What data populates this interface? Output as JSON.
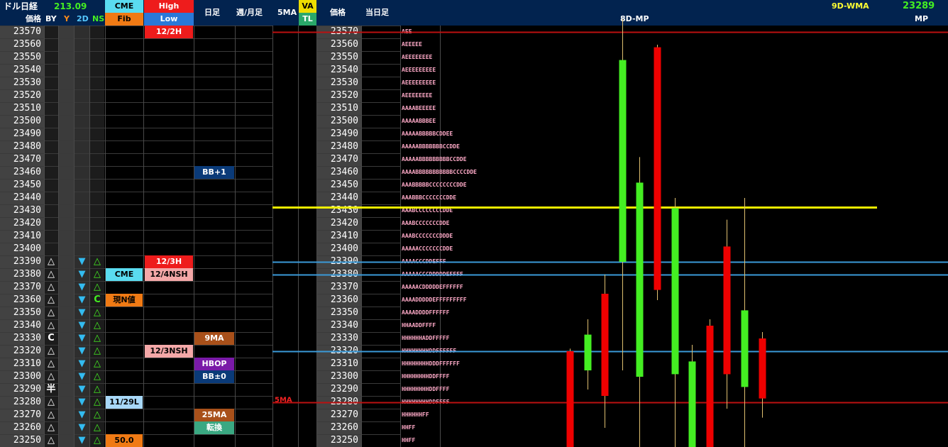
{
  "header": {
    "title": "ドル日経",
    "value": "213.09",
    "price_label": "価格",
    "by": "BY",
    "y": "Y",
    "twod": "2D",
    "ns": "NS",
    "cme": "CME",
    "fib": "Fib",
    "high": "High",
    "low": "Low",
    "daily": "日足",
    "weekly_monthly": "週/月足",
    "ma5": "5MA",
    "va": "VA",
    "tl": "TL",
    "price2": "価格",
    "today_daily": "当日足",
    "mp8d": "8D-MP",
    "wma9d": "9D-WMA",
    "mp_value": "23289",
    "mp": "MP"
  },
  "colors": {
    "header_bg": "#02234f",
    "up_candle": "#44ee22",
    "down_candle": "#ee0000",
    "yellow_line": "#eeee00",
    "blue_line": "#3a9ad8",
    "red_line": "#bb1111"
  },
  "rows": [
    {
      "price": "23570",
      "by": "",
      "y": "",
      "d2": "",
      "ns": "",
      "cme": "",
      "hl": "12/2H",
      "hl_style": "red",
      "daily": ""
    },
    {
      "price": "23560",
      "by": "",
      "y": "",
      "d2": "",
      "ns": "",
      "cme": "",
      "hl": "",
      "hl_style": "",
      "daily": ""
    },
    {
      "price": "23550",
      "by": "",
      "y": "",
      "d2": "",
      "ns": "",
      "cme": "",
      "hl": "",
      "hl_style": "",
      "daily": ""
    },
    {
      "price": "23540",
      "by": "",
      "y": "",
      "d2": "",
      "ns": "",
      "cme": "",
      "hl": "",
      "hl_style": "",
      "daily": ""
    },
    {
      "price": "23530",
      "by": "",
      "y": "",
      "d2": "",
      "ns": "",
      "cme": "",
      "hl": "",
      "hl_style": "",
      "daily": ""
    },
    {
      "price": "23520",
      "by": "",
      "y": "",
      "d2": "",
      "ns": "",
      "cme": "",
      "hl": "",
      "hl_style": "",
      "daily": ""
    },
    {
      "price": "23510",
      "by": "",
      "y": "",
      "d2": "",
      "ns": "",
      "cme": "",
      "hl": "",
      "hl_style": "",
      "daily": ""
    },
    {
      "price": "23500",
      "by": "",
      "y": "",
      "d2": "",
      "ns": "",
      "cme": "",
      "hl": "",
      "hl_style": "",
      "daily": ""
    },
    {
      "price": "23490",
      "by": "",
      "y": "",
      "d2": "",
      "ns": "",
      "cme": "",
      "hl": "",
      "hl_style": "",
      "daily": ""
    },
    {
      "price": "23480",
      "by": "",
      "y": "",
      "d2": "",
      "ns": "",
      "cme": "",
      "hl": "",
      "hl_style": "",
      "daily": ""
    },
    {
      "price": "23470",
      "by": "",
      "y": "",
      "d2": "",
      "ns": "",
      "cme": "",
      "hl": "",
      "hl_style": "",
      "daily": ""
    },
    {
      "price": "23460",
      "by": "",
      "y": "",
      "d2": "",
      "ns": "",
      "cme": "",
      "hl": "",
      "hl_style": "",
      "daily": "BB+1",
      "daily_style": "navy"
    },
    {
      "price": "23450",
      "by": "",
      "y": "",
      "d2": "",
      "ns": "",
      "cme": "",
      "hl": "",
      "hl_style": "",
      "daily": ""
    },
    {
      "price": "23440",
      "by": "",
      "y": "",
      "d2": "",
      "ns": "",
      "cme": "",
      "hl": "",
      "hl_style": "",
      "daily": ""
    },
    {
      "price": "23430",
      "by": "",
      "y": "",
      "d2": "",
      "ns": "",
      "cme": "",
      "hl": "",
      "hl_style": "",
      "daily": ""
    },
    {
      "price": "23420",
      "by": "",
      "y": "",
      "d2": "",
      "ns": "",
      "cme": "",
      "hl": "",
      "hl_style": "",
      "daily": ""
    },
    {
      "price": "23410",
      "by": "",
      "y": "",
      "d2": "",
      "ns": "",
      "cme": "",
      "hl": "",
      "hl_style": "",
      "daily": ""
    },
    {
      "price": "23400",
      "by": "",
      "y": "",
      "d2": "",
      "ns": "",
      "cme": "",
      "hl": "",
      "hl_style": "",
      "daily": ""
    },
    {
      "price": "23390",
      "by": "△",
      "y": "",
      "d2": "▼",
      "ns": "△",
      "cme": "",
      "hl": "12/3H",
      "hl_style": "red",
      "daily": ""
    },
    {
      "price": "23380",
      "by": "△",
      "y": "",
      "d2": "▼",
      "ns": "△",
      "cme": "CME",
      "cme_style": "cyan",
      "hl": "12/4NSH",
      "hl_style": "pink",
      "daily": ""
    },
    {
      "price": "23370",
      "by": "△",
      "y": "",
      "d2": "▼",
      "ns": "△",
      "cme": "",
      "hl": "",
      "hl_style": "",
      "daily": ""
    },
    {
      "price": "23360",
      "by": "△",
      "y": "",
      "d2": "▼",
      "ns": "C",
      "cme": "現N値",
      "cme_style": "orange",
      "hl": "",
      "hl_style": "",
      "daily": ""
    },
    {
      "price": "23350",
      "by": "△",
      "y": "",
      "d2": "▼",
      "ns": "△",
      "cme": "",
      "hl": "",
      "hl_style": "",
      "daily": ""
    },
    {
      "price": "23340",
      "by": "△",
      "y": "",
      "d2": "▼",
      "ns": "△",
      "cme": "",
      "hl": "",
      "hl_style": "",
      "daily": ""
    },
    {
      "price": "23330",
      "by": "C",
      "y": "",
      "d2": "▼",
      "ns": "△",
      "cme": "",
      "hl": "",
      "hl_style": "",
      "daily": "9MA",
      "daily_style": "brown"
    },
    {
      "price": "23320",
      "by": "△",
      "y": "",
      "d2": "▼",
      "ns": "△",
      "cme": "",
      "hl": "12/3NSH",
      "hl_style": "pink",
      "daily": ""
    },
    {
      "price": "23310",
      "by": "△",
      "y": "",
      "d2": "▼",
      "ns": "△",
      "cme": "",
      "hl": "",
      "hl_style": "",
      "daily": "HBOP",
      "daily_style": "purple"
    },
    {
      "price": "23300",
      "by": "△",
      "y": "",
      "d2": "▼",
      "ns": "△",
      "cme": "",
      "hl": "",
      "hl_style": "",
      "daily": "BB±0",
      "daily_style": "navy"
    },
    {
      "price": "23290",
      "by": "半",
      "y": "",
      "d2": "▼",
      "ns": "△",
      "cme": "",
      "hl": "",
      "hl_style": "",
      "daily": ""
    },
    {
      "price": "23280",
      "by": "△",
      "y": "",
      "d2": "▼",
      "ns": "△",
      "cme": "11/29L",
      "cme_style": "lightblue",
      "hl": "",
      "hl_style": "",
      "daily": ""
    },
    {
      "price": "23270",
      "by": "△",
      "y": "",
      "d2": "▼",
      "ns": "△",
      "cme": "",
      "hl": "",
      "hl_style": "",
      "daily": "25MA",
      "daily_style": "brown"
    },
    {
      "price": "23260",
      "by": "△",
      "y": "",
      "d2": "▼",
      "ns": "△",
      "cme": "",
      "hl": "",
      "hl_style": "",
      "daily": "転換",
      "daily_style": "teal"
    },
    {
      "price": "23250",
      "by": "△",
      "y": "",
      "d2": "▼",
      "ns": "△",
      "cme": "50.0",
      "cme_style": "orange",
      "hl": "",
      "hl_style": "",
      "daily": ""
    }
  ],
  "market_profile": [
    "AEE",
    "AEEEEE",
    "AEEEEEEEE",
    "AEEEEEEEEE",
    "AEEEEEEEEE",
    "AEEEEEEEE",
    "AAAABEEEEE",
    "AAAAABBBEE",
    "AAAAABBBBBCDDEE",
    "AAAAABBBBBBBCCDDE",
    "AAAAABBBBBBBBBCCDDE",
    "AAAABBBBBBBBBBBCCCCDDE",
    "AAABBBBBCCCCCCCCDDE",
    "AAABBBCCCCCCCDDE",
    "AAABCCCCCCCCDDE",
    "AAABCCCCCCCDDE",
    "AAABCCCCCCCDDDE",
    "AAAAACCCCCCCDDE",
    "AAAACCCDDEFFF",
    "AAAAACCCDDDDDEFFFF",
    "AAAAACDDDDDEFFFFFF",
    "AAAADDDDDEFFFFFFFFF",
    "AAAADDDDFFFFFF",
    "HHAADDFFFF",
    "HHHHHHADDFFFFF",
    "HHHHHHHHDDFFFFFF",
    "HHHHHHHHDDDFFFFFF",
    "HHHHHHHHDDFFFF",
    "HHHHHHHHDDFFFF",
    "HHHHHHHHDDFFFF",
    "HHHHHHFF",
    "HHFF",
    "HHFF"
  ],
  "chart_data": {
    "type": "candlestick",
    "title": "8D-MP",
    "ylim": [
      23245,
      23575
    ],
    "overlay_lines": [
      {
        "value": 23433,
        "color": "#eeee00",
        "label": ""
      },
      {
        "value": 23390,
        "color": "#3a9ad8",
        "label": ""
      },
      {
        "value": 23380,
        "color": "#3a9ad8",
        "label": ""
      },
      {
        "value": 23320,
        "color": "#3a9ad8",
        "label": ""
      },
      {
        "value": 23570,
        "color": "#bb1111",
        "label": ""
      },
      {
        "value": 23280,
        "color": "#bb1111",
        "label": "5MA"
      }
    ],
    "candles": [
      {
        "open": 23320,
        "close": 23180,
        "high": 23322,
        "low": 23170,
        "dir": "down"
      },
      {
        "open": 23305,
        "close": 23333,
        "high": 23345,
        "low": 23290,
        "dir": "up"
      },
      {
        "open": 23365,
        "close": 23285,
        "high": 23380,
        "low": 23260,
        "dir": "down"
      },
      {
        "open": 23390,
        "close": 23548,
        "high": 23580,
        "low": 23305,
        "dir": "up"
      },
      {
        "open": 23300,
        "close": 23452,
        "high": 23472,
        "low": 23240,
        "dir": "up"
      },
      {
        "open": 23558,
        "close": 23368,
        "high": 23560,
        "low": 23360,
        "dir": "down"
      },
      {
        "open": 23302,
        "close": 23432,
        "high": 23440,
        "low": 23210,
        "dir": "up"
      },
      {
        "open": 23190,
        "close": 23312,
        "high": 23325,
        "low": 23170,
        "dir": "up"
      },
      {
        "open": 23340,
        "close": 23190,
        "high": 23345,
        "low": 23140,
        "dir": "down"
      },
      {
        "open": 23402,
        "close": 23302,
        "high": 23423,
        "low": 23275,
        "dir": "down"
      },
      {
        "open": 23292,
        "close": 23352,
        "high": 23440,
        "low": 23230,
        "dir": "up"
      },
      {
        "open": 23330,
        "close": 23283,
        "high": 23335,
        "low": 23268,
        "dir": "down"
      },
      {
        "open": 23390,
        "close": 23452,
        "high": 23580,
        "low": 23340,
        "dir": "up"
      },
      {
        "open": 23480,
        "close": 23460,
        "high": 23502,
        "low": 23390,
        "dir": "down"
      },
      {
        "open": 23412,
        "close": 23482,
        "high": 23492,
        "low": 23375,
        "dir": "up"
      },
      {
        "open": 23292,
        "close": 23482,
        "high": 23492,
        "low": 23250,
        "dir": "up"
      },
      {
        "open": 23562,
        "close": 23372,
        "high": 23572,
        "low": 23366,
        "dir": "down"
      },
      {
        "open": 23330,
        "close": 23210,
        "high": 23387,
        "low": 23200,
        "dir": "down"
      }
    ]
  }
}
